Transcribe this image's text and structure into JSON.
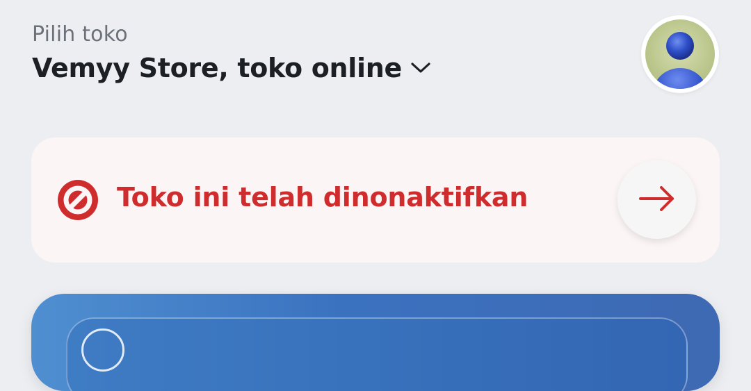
{
  "header": {
    "label": "Pilih toko",
    "store_name": "Vemyy Store, toko online"
  },
  "avatar": {
    "icon": "user-avatar-icon"
  },
  "alert": {
    "text": "Toko ini telah dinonaktifkan",
    "icon": "block-icon",
    "action_icon": "arrow-right-icon",
    "color": "#cf2d2d",
    "background": "#fbf5f5"
  },
  "promo": {
    "color": "#3b72c0"
  }
}
